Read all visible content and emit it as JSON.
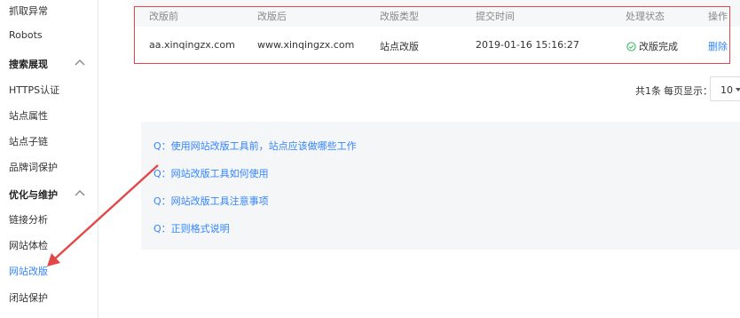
{
  "sidebar": {
    "items": [
      {
        "label": "抓取异常",
        "active": false
      },
      {
        "label": "Robots",
        "active": false
      },
      {
        "label": "搜索展现",
        "group": true
      },
      {
        "label": "HTTPS认证",
        "active": false
      },
      {
        "label": "站点属性",
        "active": false
      },
      {
        "label": "站点子链",
        "active": false
      },
      {
        "label": "品牌词保护",
        "active": false
      },
      {
        "label": "优化与维护",
        "group": true
      },
      {
        "label": "链接分析",
        "active": false
      },
      {
        "label": "网站体检",
        "active": false
      },
      {
        "label": "网站改版",
        "active": true
      },
      {
        "label": "闭站保护",
        "active": false
      }
    ]
  },
  "table": {
    "headers": [
      "改版前",
      "改版后",
      "改版类型",
      "提交时间",
      "处理状态",
      "操作"
    ],
    "rows": [
      {
        "before": "aa.xinqingzx.com",
        "after": "www.xinqingzx.com",
        "type": "站点改版",
        "time": "2019-01-16 15:16:27",
        "status": "改版完成",
        "action": "删除"
      }
    ]
  },
  "pagination": {
    "total": "共1条",
    "page_size_label": "每页显示：",
    "page_size": "10"
  },
  "faq": [
    "Q：使用网站改版工具前，站点应该做哪些工作",
    "Q：网站改版工具如何使用",
    "Q：网站改版工具注意事项",
    "Q：正则格式说明"
  ],
  "colors": {
    "accent": "#3385ff",
    "success": "#2db55d",
    "annotation": "#e24848"
  }
}
